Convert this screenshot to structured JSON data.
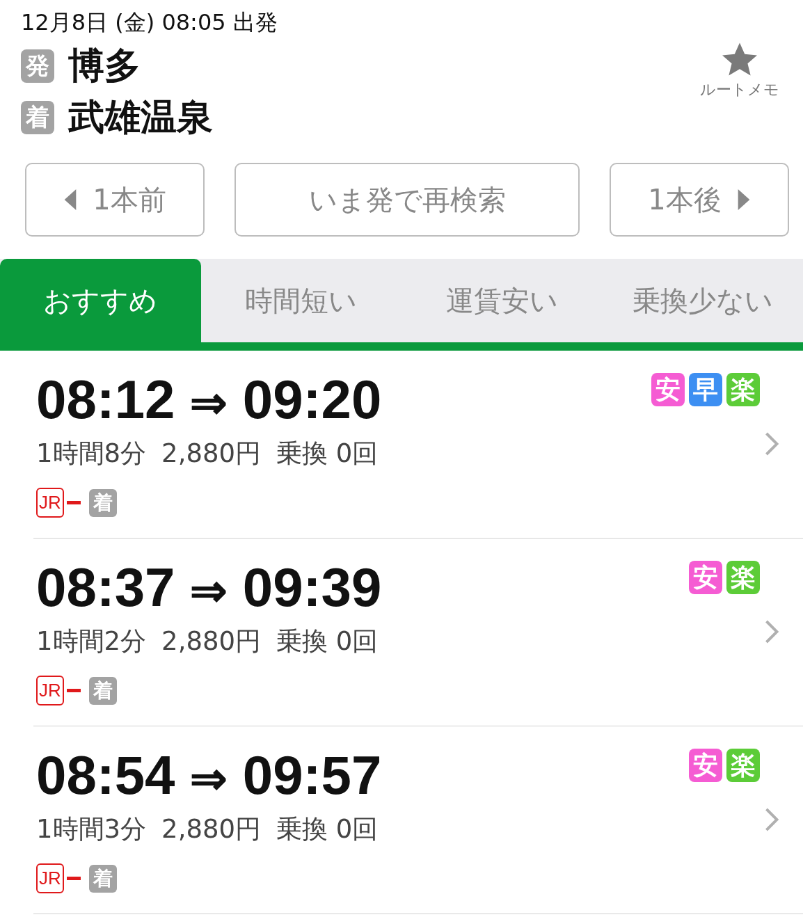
{
  "header": {
    "datetime": "12月8日 (金) 08:05 出発",
    "from": {
      "badge": "発",
      "name": "博多"
    },
    "to": {
      "badge": "着",
      "name": "武雄温泉"
    },
    "memo": {
      "label": "ルートメモ"
    }
  },
  "nav": {
    "prev": "1本前",
    "research": "いま発で再検索",
    "next": "1本後"
  },
  "tabs": [
    {
      "label": "おすすめ",
      "selected": true
    },
    {
      "label": "時間短い",
      "selected": false
    },
    {
      "label": "運賃安い",
      "selected": false
    },
    {
      "label": "乗換少ない",
      "selected": false
    }
  ],
  "routes": [
    {
      "depart": "08:12",
      "arrow": "⇒",
      "arrive": "09:20",
      "duration": "1時間8分",
      "fare": "2,880円",
      "transfers": "乗換 0回",
      "tags": [
        {
          "label": "安",
          "color": "#f55cd3"
        },
        {
          "label": "早",
          "color": "#3d8ff2"
        },
        {
          "label": "楽",
          "color": "#5ccc38"
        }
      ],
      "line": "JR",
      "end": "着"
    },
    {
      "depart": "08:37",
      "arrow": "⇒",
      "arrive": "09:39",
      "duration": "1時間2分",
      "fare": "2,880円",
      "transfers": "乗換 0回",
      "tags": [
        {
          "label": "安",
          "color": "#f55cd3"
        },
        {
          "label": "楽",
          "color": "#5ccc38"
        }
      ],
      "line": "JR",
      "end": "着"
    },
    {
      "depart": "08:54",
      "arrow": "⇒",
      "arrive": "09:57",
      "duration": "1時間3分",
      "fare": "2,880円",
      "transfers": "乗換 0回",
      "tags": [
        {
          "label": "安",
          "color": "#f55cd3"
        },
        {
          "label": "楽",
          "color": "#5ccc38"
        }
      ],
      "line": "JR",
      "end": "着"
    }
  ]
}
